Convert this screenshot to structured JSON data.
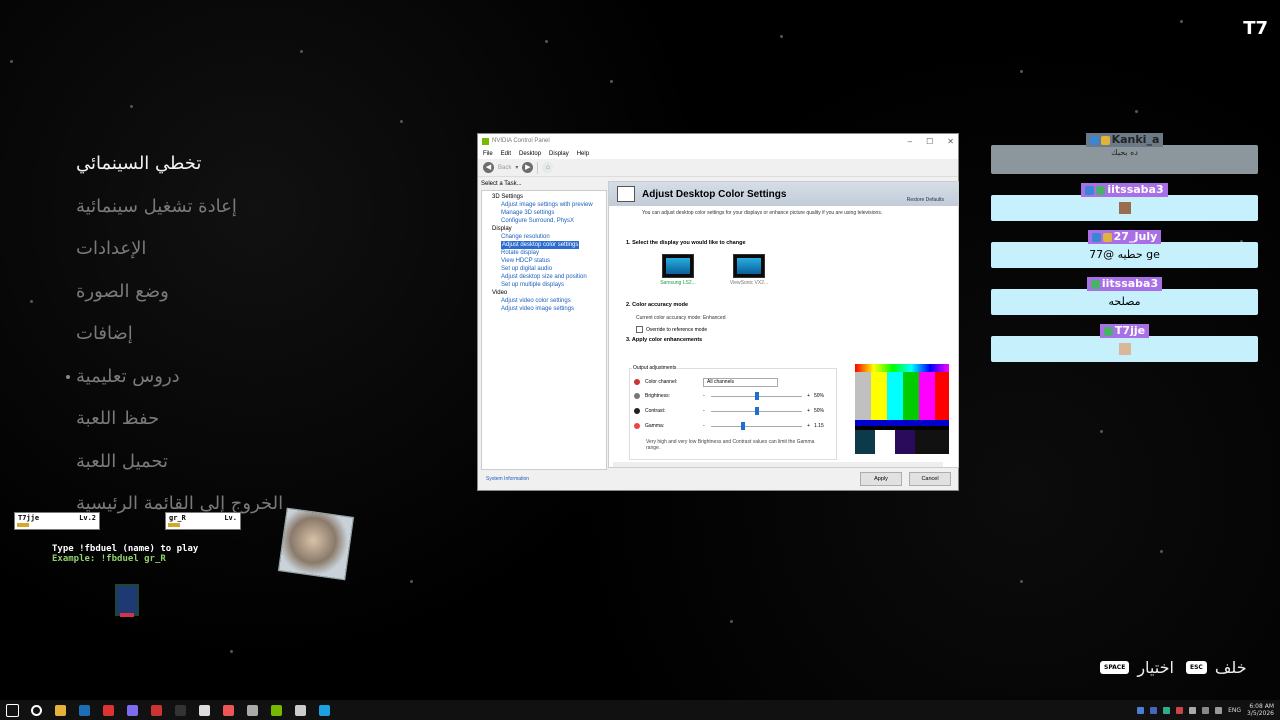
{
  "logo": "T7",
  "menu": {
    "items": [
      {
        "label": "تخطي السينمائي"
      },
      {
        "label": "إعادة تشغيل سينمائية"
      },
      {
        "label": "الإعدادات"
      },
      {
        "label": "وضع الصورة"
      },
      {
        "label": "إضافات"
      },
      {
        "label": "دروس تعليمية"
      },
      {
        "label": "حفظ اللعبة"
      },
      {
        "label": "تحميل اللعبة"
      },
      {
        "label": "الخروج إلى القائمة الرئيسية"
      }
    ]
  },
  "game_overlay": {
    "player1": {
      "name": "T7jje",
      "level": "Lv.2"
    },
    "player2": {
      "name": "gr_R",
      "level": "Lv."
    },
    "line1": "Type !fbduel (name) to play",
    "line2": "Example: !fbduel gr_R"
  },
  "chat": [
    {
      "user": "Kanki_a",
      "text": "ده بحبك",
      "style": "grey"
    },
    {
      "user": "iitssaba3",
      "text": "",
      "style": "blue"
    },
    {
      "user": "27_July",
      "text": "77@ حطيه ge",
      "style": "blue"
    },
    {
      "user": "iitssaba3",
      "text": "مصلحه",
      "style": "blue"
    },
    {
      "user": "T7jje",
      "text": "",
      "style": "blue"
    }
  ],
  "nvidia": {
    "title": "NVIDIA Control Panel",
    "menubar": [
      "File",
      "Edit",
      "Desktop",
      "Display",
      "Help"
    ],
    "back_label": "Back",
    "task_label": "Select a Task...",
    "tree": [
      {
        "type": "cat",
        "label": "3D Settings"
      },
      {
        "type": "leaf",
        "label": "Adjust image settings with preview"
      },
      {
        "type": "leaf",
        "label": "Manage 3D settings"
      },
      {
        "type": "leaf",
        "label": "Configure Surround, PhysX"
      },
      {
        "type": "cat",
        "label": "Display"
      },
      {
        "type": "leaf",
        "label": "Change resolution"
      },
      {
        "type": "sel",
        "label": "Adjust desktop color settings"
      },
      {
        "type": "leaf",
        "label": "Rotate display"
      },
      {
        "type": "leaf",
        "label": "View HDCP status"
      },
      {
        "type": "leaf",
        "label": "Set up digital audio"
      },
      {
        "type": "leaf",
        "label": "Adjust desktop size and position"
      },
      {
        "type": "leaf",
        "label": "Set up multiple displays"
      },
      {
        "type": "cat",
        "label": "Video"
      },
      {
        "type": "leaf",
        "label": "Adjust video color settings"
      },
      {
        "type": "leaf",
        "label": "Adjust video image settings"
      }
    ],
    "page_title": "Adjust Desktop Color Settings",
    "restore_defaults": "Restore Defaults",
    "description": "You can adjust desktop color settings for your displays or enhance picture quality if you are using televisions.",
    "sec1": "1. Select the display you would like to change",
    "displays": [
      "Samsung LS2...",
      "ViewSonic VX2..."
    ],
    "sec2": "2. Color accuracy mode",
    "accuracy_text": "Current color accuracy mode: Enhanced",
    "override_label": "Override to reference mode",
    "sec3": "3. Apply color enhancements",
    "output_label": "Output adjustments",
    "color_channel_label": "Color channel:",
    "color_channel_value": "All channels",
    "brightness_label": "Brightness:",
    "brightness_value": "50%",
    "brightness_level": 0.5,
    "contrast_label": "Contrast:",
    "contrast_value": "50%",
    "contrast_level": 0.5,
    "gamma_label": "Gamma:",
    "gamma_value": "1.15",
    "gamma_level": 0.35,
    "minus": "-",
    "plus": "+",
    "warning": "Very high and very low Brightness and Contrast values can limit the Gamma range.",
    "system_info": "System Information",
    "apply": "Apply",
    "cancel": "Cancel"
  },
  "hints": {
    "back": {
      "key": "ESC",
      "label": "خلف"
    },
    "select": {
      "key": "SPACE",
      "label": "اختيار"
    }
  },
  "taskbar": {
    "time": "6:08 AM",
    "date": "3/5/2026",
    "lang": "ENG",
    "apps": [
      "start-icon",
      "search-icon",
      "file-explorer-icon",
      "steam-icon",
      "app-red-icon",
      "discord-icon",
      "app-red-2-icon",
      "obs-icon",
      "app-3-icon",
      "app-4-icon",
      "app-5-icon",
      "nvidia-icon",
      "app-6-icon",
      "edge-icon"
    ]
  }
}
